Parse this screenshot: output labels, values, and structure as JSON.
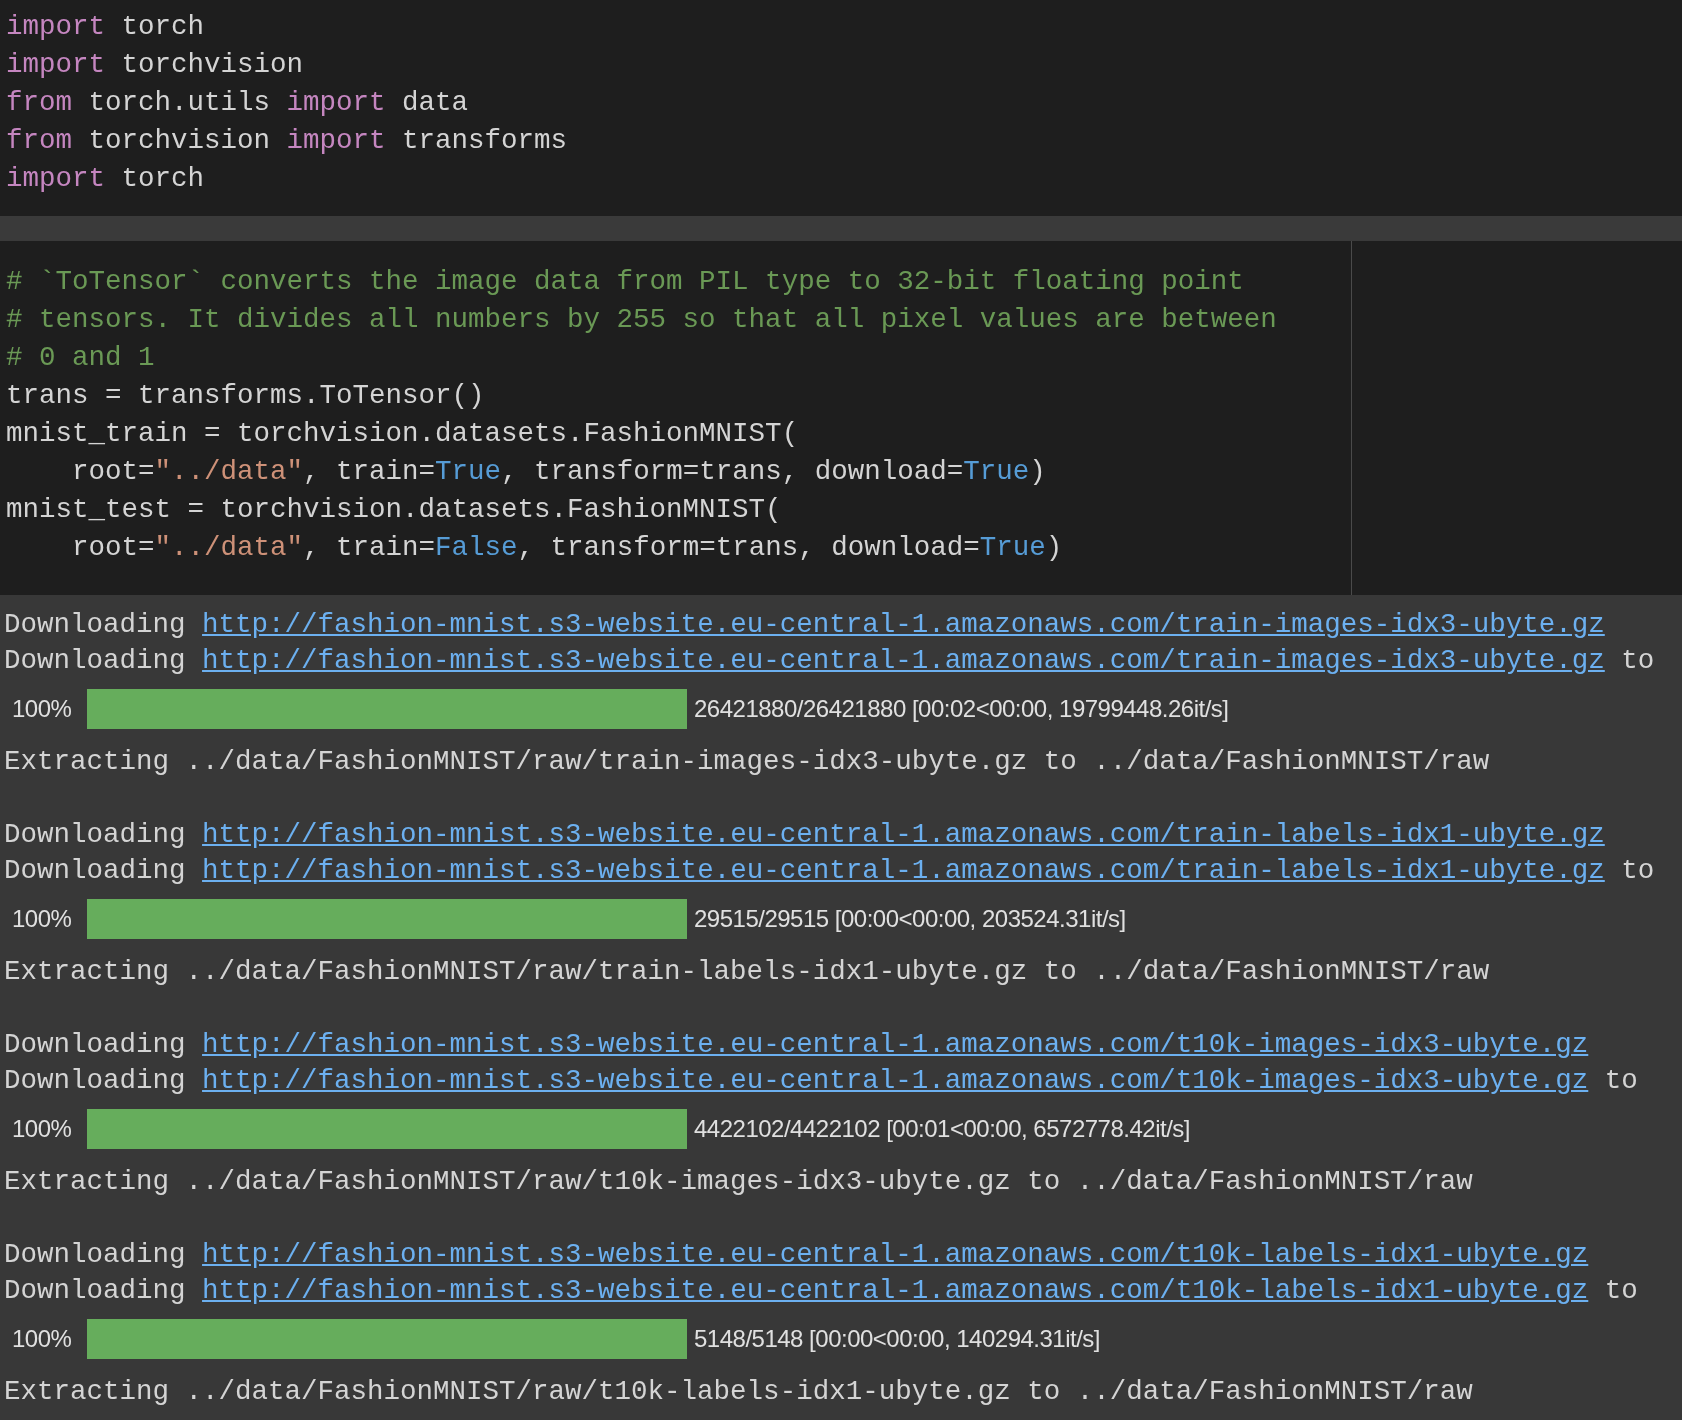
{
  "code_cells": [
    {
      "ruler": false,
      "lines": [
        [
          {
            "kind": "keyword",
            "text": "import"
          },
          {
            "kind": "plain",
            "text": " torch"
          }
        ],
        [
          {
            "kind": "keyword",
            "text": "import"
          },
          {
            "kind": "plain",
            "text": " torchvision"
          }
        ],
        [
          {
            "kind": "keyword",
            "text": "from"
          },
          {
            "kind": "plain",
            "text": " torch.utils "
          },
          {
            "kind": "keyword",
            "text": "import"
          },
          {
            "kind": "plain",
            "text": " data"
          }
        ],
        [
          {
            "kind": "keyword",
            "text": "from"
          },
          {
            "kind": "plain",
            "text": " torchvision "
          },
          {
            "kind": "keyword",
            "text": "import"
          },
          {
            "kind": "plain",
            "text": " transforms"
          }
        ],
        [
          {
            "kind": "keyword",
            "text": "import"
          },
          {
            "kind": "plain",
            "text": " torch"
          }
        ]
      ]
    },
    {
      "ruler": true,
      "lines": [
        [
          {
            "kind": "comment",
            "text": "# `ToTensor` converts the image data from PIL type to 32-bit floating point"
          }
        ],
        [
          {
            "kind": "comment",
            "text": "# tensors. It divides all numbers by 255 so that all pixel values are between"
          }
        ],
        [
          {
            "kind": "comment",
            "text": "# 0 and 1"
          }
        ],
        [
          {
            "kind": "plain",
            "text": "trans = transforms.ToTensor()"
          }
        ],
        [
          {
            "kind": "plain",
            "text": "mnist_train = torchvision.datasets.FashionMNIST("
          }
        ],
        [
          {
            "kind": "plain",
            "text": "    root="
          },
          {
            "kind": "string",
            "text": "\"../data\""
          },
          {
            "kind": "plain",
            "text": ", train="
          },
          {
            "kind": "constant",
            "text": "True"
          },
          {
            "kind": "plain",
            "text": ", transform=trans, download="
          },
          {
            "kind": "constant",
            "text": "True"
          },
          {
            "kind": "plain",
            "text": ")"
          }
        ],
        [
          {
            "kind": "plain",
            "text": "mnist_test = torchvision.datasets.FashionMNIST("
          }
        ],
        [
          {
            "kind": "plain",
            "text": "    root="
          },
          {
            "kind": "string",
            "text": "\"../data\""
          },
          {
            "kind": "plain",
            "text": ", train="
          },
          {
            "kind": "constant",
            "text": "False"
          },
          {
            "kind": "plain",
            "text": ", transform=trans, download="
          },
          {
            "kind": "constant",
            "text": "True"
          },
          {
            "kind": "plain",
            "text": ")"
          }
        ]
      ]
    }
  ],
  "output": [
    {
      "kind": "download",
      "prefix": "Downloading",
      "url": "http://fashion-mnist.s3-website.eu-central-1.amazonaws.com/train-images-idx3-ubyte.gz"
    },
    {
      "kind": "download",
      "prefix": "Downloading",
      "url": "http://fashion-mnist.s3-website.eu-central-1.amazonaws.com/train-images-idx3-ubyte.gz",
      "suffix": "to"
    },
    {
      "kind": "progress",
      "percent": "100%",
      "level": 1,
      "stats": "26421880/26421880 [00:02<00:00, 19799448.26it/s]"
    },
    {
      "kind": "text",
      "text": "Extracting ../data/FashionMNIST/raw/train-images-idx3-ubyte.gz to ../data/FashionMNIST/raw"
    },
    {
      "kind": "blank"
    },
    {
      "kind": "download",
      "prefix": "Downloading",
      "url": "http://fashion-mnist.s3-website.eu-central-1.amazonaws.com/train-labels-idx1-ubyte.gz"
    },
    {
      "kind": "download",
      "prefix": "Downloading",
      "url": "http://fashion-mnist.s3-website.eu-central-1.amazonaws.com/train-labels-idx1-ubyte.gz",
      "suffix": "to"
    },
    {
      "kind": "progress",
      "percent": "100%",
      "level": 1,
      "stats": "29515/29515 [00:00<00:00, 203524.31it/s]"
    },
    {
      "kind": "text",
      "text": "Extracting ../data/FashionMNIST/raw/train-labels-idx1-ubyte.gz to ../data/FashionMNIST/raw"
    },
    {
      "kind": "blank"
    },
    {
      "kind": "download",
      "prefix": "Downloading",
      "url": "http://fashion-mnist.s3-website.eu-central-1.amazonaws.com/t10k-images-idx3-ubyte.gz"
    },
    {
      "kind": "download",
      "prefix": "Downloading",
      "url": "http://fashion-mnist.s3-website.eu-central-1.amazonaws.com/t10k-images-idx3-ubyte.gz",
      "suffix": "to"
    },
    {
      "kind": "progress",
      "percent": "100%",
      "level": 1,
      "stats": "4422102/4422102 [00:01<00:00, 6572778.42it/s]"
    },
    {
      "kind": "text",
      "text": "Extracting ../data/FashionMNIST/raw/t10k-images-idx3-ubyte.gz to ../data/FashionMNIST/raw"
    },
    {
      "kind": "blank"
    },
    {
      "kind": "download",
      "prefix": "Downloading",
      "url": "http://fashion-mnist.s3-website.eu-central-1.amazonaws.com/t10k-labels-idx1-ubyte.gz"
    },
    {
      "kind": "download",
      "prefix": "Downloading",
      "url": "http://fashion-mnist.s3-website.eu-central-1.amazonaws.com/t10k-labels-idx1-ubyte.gz",
      "suffix": "to"
    },
    {
      "kind": "progress",
      "percent": "100%",
      "level": 1,
      "stats": "5148/5148 [00:00<00:00, 140294.31it/s]"
    },
    {
      "kind": "text",
      "text": "Extracting ../data/FashionMNIST/raw/t10k-labels-idx1-ubyte.gz to ../data/FashionMNIST/raw"
    }
  ]
}
